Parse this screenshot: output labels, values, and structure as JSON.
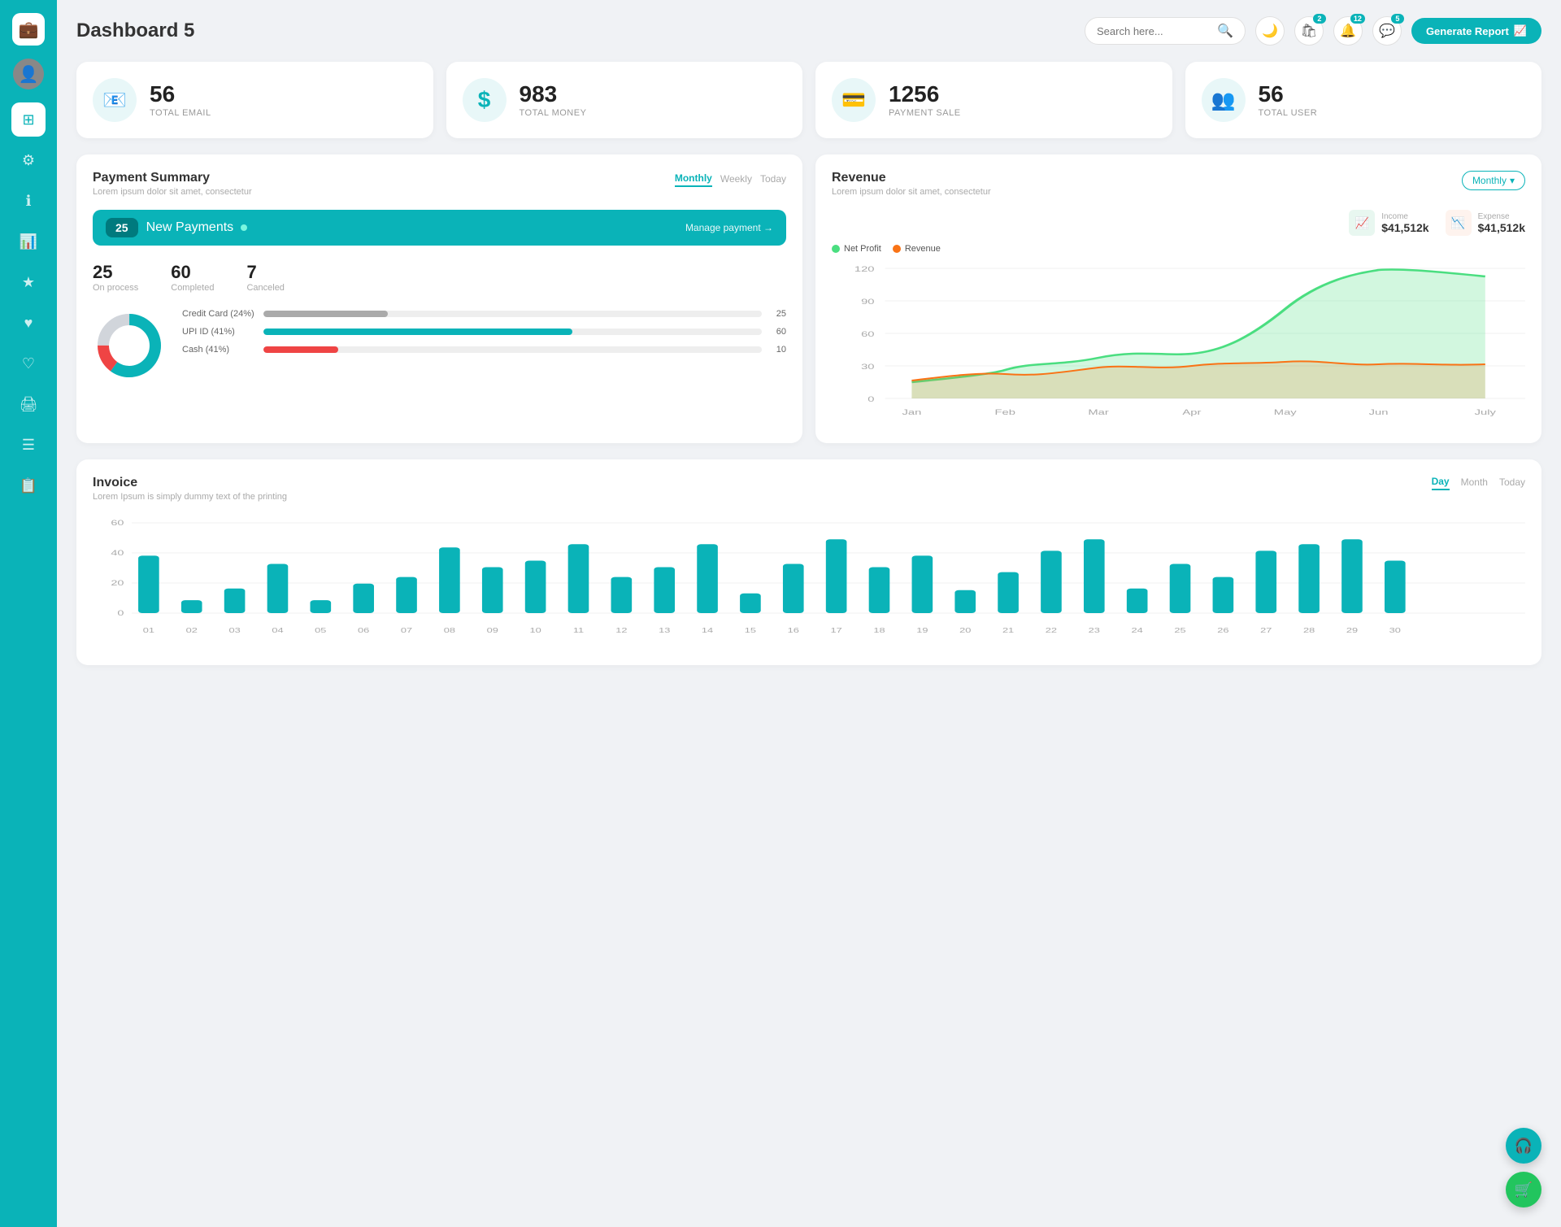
{
  "sidebar": {
    "logo_icon": "💼",
    "items": [
      {
        "id": "dashboard",
        "icon": "⊞",
        "active": true
      },
      {
        "id": "settings",
        "icon": "⚙"
      },
      {
        "id": "info",
        "icon": "ℹ"
      },
      {
        "id": "chart",
        "icon": "📊"
      },
      {
        "id": "star",
        "icon": "★"
      },
      {
        "id": "heart-solid",
        "icon": "♥"
      },
      {
        "id": "heart-outline",
        "icon": "♡"
      },
      {
        "id": "print",
        "icon": "🖨"
      },
      {
        "id": "list",
        "icon": "☰"
      },
      {
        "id": "file",
        "icon": "📋"
      }
    ]
  },
  "header": {
    "title": "Dashboard 5",
    "search_placeholder": "Search here...",
    "generate_btn": "Generate Report",
    "badges": {
      "cart": "2",
      "bell": "12",
      "message": "5"
    }
  },
  "stats": [
    {
      "id": "email",
      "value": "56",
      "label": "TOTAL EMAIL",
      "icon": "📧"
    },
    {
      "id": "money",
      "value": "983",
      "label": "TOTAL MONEY",
      "icon": "$"
    },
    {
      "id": "payment",
      "value": "1256",
      "label": "PAYMENT SALE",
      "icon": "💳"
    },
    {
      "id": "users",
      "value": "56",
      "label": "TOTAL USER",
      "icon": "👥"
    }
  ],
  "payment_summary": {
    "title": "Payment Summary",
    "subtitle": "Lorem ipsum dolor sit amet, consectetur",
    "tabs": [
      "Monthly",
      "Weekly",
      "Today"
    ],
    "active_tab": "Monthly",
    "new_payments_count": "25",
    "new_payments_label": "New Payments",
    "manage_link": "Manage payment →",
    "on_process": {
      "value": "25",
      "label": "On process"
    },
    "completed": {
      "value": "60",
      "label": "Completed"
    },
    "canceled": {
      "value": "7",
      "label": "Canceled"
    },
    "progress_bars": [
      {
        "label": "Credit Card (24%)",
        "percent": 25,
        "value": 25,
        "color": "#aaa"
      },
      {
        "label": "UPI ID (41%)",
        "percent": 62,
        "value": 60,
        "color": "#0ab3b8"
      },
      {
        "label": "Cash (41%)",
        "percent": 15,
        "value": 10,
        "color": "#ef4444"
      }
    ],
    "donut": {
      "green_percent": 60,
      "red_percent": 15,
      "gray_percent": 25
    }
  },
  "revenue": {
    "title": "Revenue",
    "subtitle": "Lorem ipsum dolor sit amet, consectetur",
    "dropdown_label": "Monthly",
    "income": {
      "label": "Income",
      "value": "$41,512k"
    },
    "expense": {
      "label": "Expense",
      "value": "$41,512k"
    },
    "legend": [
      {
        "label": "Net Profit",
        "color": "#4ade80"
      },
      {
        "label": "Revenue",
        "color": "#f97316"
      }
    ],
    "months": [
      "Jan",
      "Feb",
      "Mar",
      "Apr",
      "May",
      "Jun",
      "July"
    ],
    "y_labels": [
      "120",
      "90",
      "60",
      "30",
      "0"
    ]
  },
  "invoice": {
    "title": "Invoice",
    "subtitle": "Lorem Ipsum is simply dummy text of the printing",
    "tabs": [
      "Day",
      "Month",
      "Today"
    ],
    "active_tab": "Day",
    "y_labels": [
      "0",
      "20",
      "40",
      "60"
    ],
    "x_labels": [
      "01",
      "02",
      "03",
      "04",
      "05",
      "06",
      "07",
      "08",
      "09",
      "10",
      "11",
      "12",
      "13",
      "14",
      "15",
      "16",
      "17",
      "18",
      "19",
      "20",
      "21",
      "22",
      "23",
      "24",
      "25",
      "26",
      "27",
      "28",
      "29",
      "30"
    ],
    "bars": [
      35,
      8,
      15,
      30,
      8,
      18,
      22,
      40,
      28,
      32,
      42,
      22,
      28,
      42,
      12,
      30,
      45,
      28,
      35,
      14,
      25,
      38,
      45,
      15,
      30,
      22,
      38,
      42,
      45,
      32
    ]
  },
  "fab": {
    "headset_icon": "🎧",
    "cart_icon": "🛒"
  }
}
